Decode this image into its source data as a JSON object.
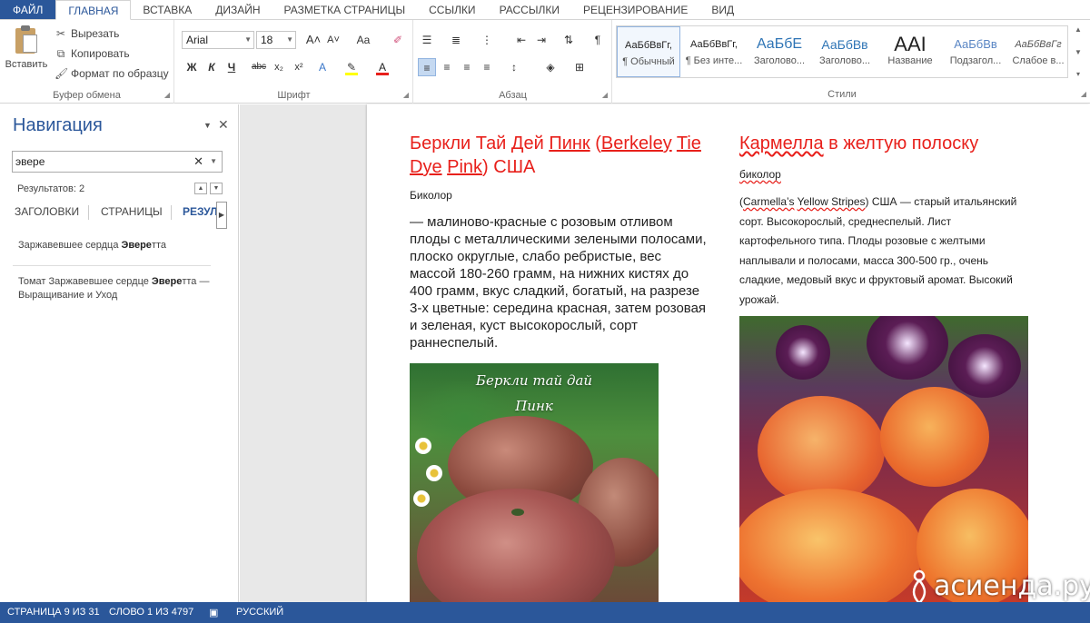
{
  "ribbon_tabs": [
    "ФАЙЛ",
    "ГЛАВНАЯ",
    "ВСТАВКА",
    "ДИЗАЙН",
    "РАЗМЕТКА СТРАНИЦЫ",
    "ССЫЛКИ",
    "РАССЫЛКИ",
    "РЕЦЕНЗИРОВАНИЕ",
    "ВИД"
  ],
  "clipboard": {
    "paste": "Вставить",
    "cut": "Вырезать",
    "copy": "Копировать",
    "format_painter": "Формат по образцу",
    "group_label": "Буфер обмена"
  },
  "font": {
    "name": "Arial",
    "size": "18",
    "bold": "Ж",
    "italic": "К",
    "underline": "Ч",
    "strike": "abc",
    "sub": "x₂",
    "sup": "x²",
    "grow": "A˄",
    "shrink": "A˅",
    "case": "Aa",
    "group_label": "Шрифт"
  },
  "paragraph": {
    "group_label": "Абзац"
  },
  "styles": {
    "items": [
      {
        "sample": "АаБбВвГг,",
        "name": "¶ Обычный"
      },
      {
        "sample": "АаБбВвГг,",
        "name": "¶ Без инте..."
      },
      {
        "sample": "АаБбЕ",
        "name": "Заголово..."
      },
      {
        "sample": "АаБбВв",
        "name": "Заголово..."
      },
      {
        "sample": "ААІ",
        "name": "Название"
      },
      {
        "sample": "АаБбВв",
        "name": "Подзагол..."
      },
      {
        "sample": "АаБбВвГг",
        "name": "Слабое в..."
      }
    ],
    "group_label": "Стили"
  },
  "nav": {
    "title": "Навигация",
    "search_value": "эвере",
    "results_count": "Результатов: 2",
    "tabs": [
      "ЗАГОЛОВКИ",
      "СТРАНИЦЫ",
      "РЕЗУЛ"
    ],
    "results": [
      {
        "pre": "Заржавевшее сердца ",
        "bold": "Эвере",
        "post": "тта"
      },
      {
        "pre": "Томат Заржавевшее сердце ",
        "bold": "Эвере",
        "post": "тта — Выращивание и Уход"
      }
    ]
  },
  "doc": {
    "left": {
      "title_a": "Беркли Тай Дей ",
      "title_b": "Пинк",
      "title_c": " (",
      "title_d": "Berkeley",
      "title_e": "Tie",
      "title_f": " ",
      "title_g": "Dye",
      "title_h": " ",
      "title_i": "Pink",
      "title_j": ") США",
      "subtitle": "Биколор",
      "body": "— малиново-красные с розовым отливом плоды с металлическими зелеными полосами, плоско округлые, слабо ребристые, вес массой 180-260 грамм, на нижних кистях до 400 грамм, вкус сладкий, богатый, на разрезе 3-х цветные: середина красная, затем розовая и зеленая, куст высокорослый, сорт раннеспелый.",
      "photo_caption_1": "Беркли тай дай",
      "photo_caption_2": "Пинк"
    },
    "right": {
      "title_a": "Кармелла",
      "title_b": " в желтую полоску",
      "subtitle": "биколор",
      "body_a": "(",
      "body_b": "Carmella’s",
      "body_c": " ",
      "body_d": "Yellow Stripes",
      "body_e": ") США — старый итальянский сорт. Высокорослый, среднеспелый. Лист картофельного типа. Плоды розовые с желтыми наплывали и полосами, масса 300-500 гр., очень сладкие, медовый вкус и фруктовый аромат. Высокий урожай."
    }
  },
  "status": {
    "page": "СТРАНИЦА 9 ИЗ 31",
    "words": "СЛОВО 1 ИЗ 4797",
    "language": "РУССКИЙ"
  },
  "watermark": "асиенда.ру",
  "colors": {
    "accent": "#2b579a",
    "heading_red": "#e8201b"
  }
}
